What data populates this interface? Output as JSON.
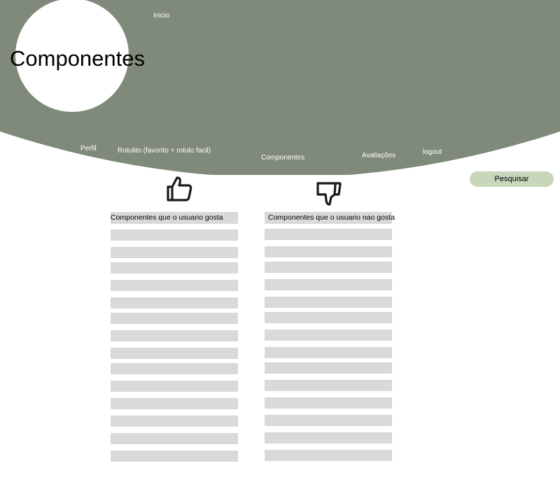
{
  "page": {
    "title": "Componentes"
  },
  "colors": {
    "header_bg": "#7f8a7a",
    "row_bg": "#d9d9d9",
    "search_bg": "#c8d6bc"
  },
  "nav": {
    "inicio": "Inicio",
    "perfil": "Perfil",
    "rotulito": "Rotulito (favorito + rotulo facil)",
    "componentes": "Componentes",
    "avaliacoes": "Avaliações",
    "logout": "logout"
  },
  "search": {
    "label": "Pesquisar"
  },
  "liked": {
    "icon": "thumbs-up-icon",
    "header": "Componentes que o usuario gosta",
    "rows": [
      "",
      "",
      "",
      "",
      "",
      "",
      "",
      "",
      "",
      "",
      "",
      "",
      "",
      ""
    ]
  },
  "disliked": {
    "icon": "thumbs-down-icon",
    "header": "Componentes que o usuario nao gosta",
    "rows": [
      "",
      "",
      "",
      "",
      "",
      "",
      "",
      "",
      "",
      "",
      "",
      "",
      "",
      ""
    ]
  }
}
